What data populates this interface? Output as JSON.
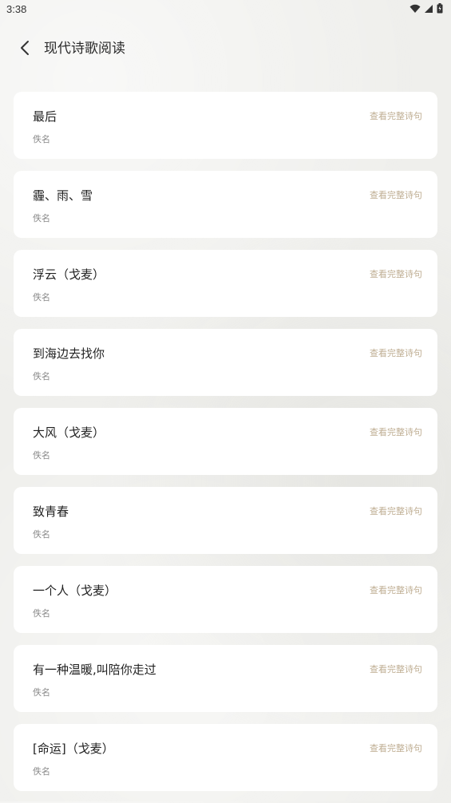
{
  "status": {
    "time": "3:38"
  },
  "header": {
    "title": "现代诗歌阅读"
  },
  "poems": [
    {
      "title": "最后",
      "author": "佚名",
      "link": "查看完整诗句"
    },
    {
      "title": "霾、雨、雪",
      "author": "佚名",
      "link": "查看完整诗句"
    },
    {
      "title": "浮云（戈麦）",
      "author": "佚名",
      "link": "查看完整诗句"
    },
    {
      "title": "到海边去找你",
      "author": "佚名",
      "link": "查看完整诗句"
    },
    {
      "title": "大风（戈麦）",
      "author": "佚名",
      "link": "查看完整诗句"
    },
    {
      "title": "致青春",
      "author": "佚名",
      "link": "查看完整诗句"
    },
    {
      "title": "一个人（戈麦）",
      "author": "佚名",
      "link": "查看完整诗句"
    },
    {
      "title": "有一种温暖,叫陪你走过",
      "author": "佚名",
      "link": "查看完整诗句"
    },
    {
      "title": "[命运]（戈麦）",
      "author": "佚名",
      "link": "查看完整诗句"
    }
  ]
}
